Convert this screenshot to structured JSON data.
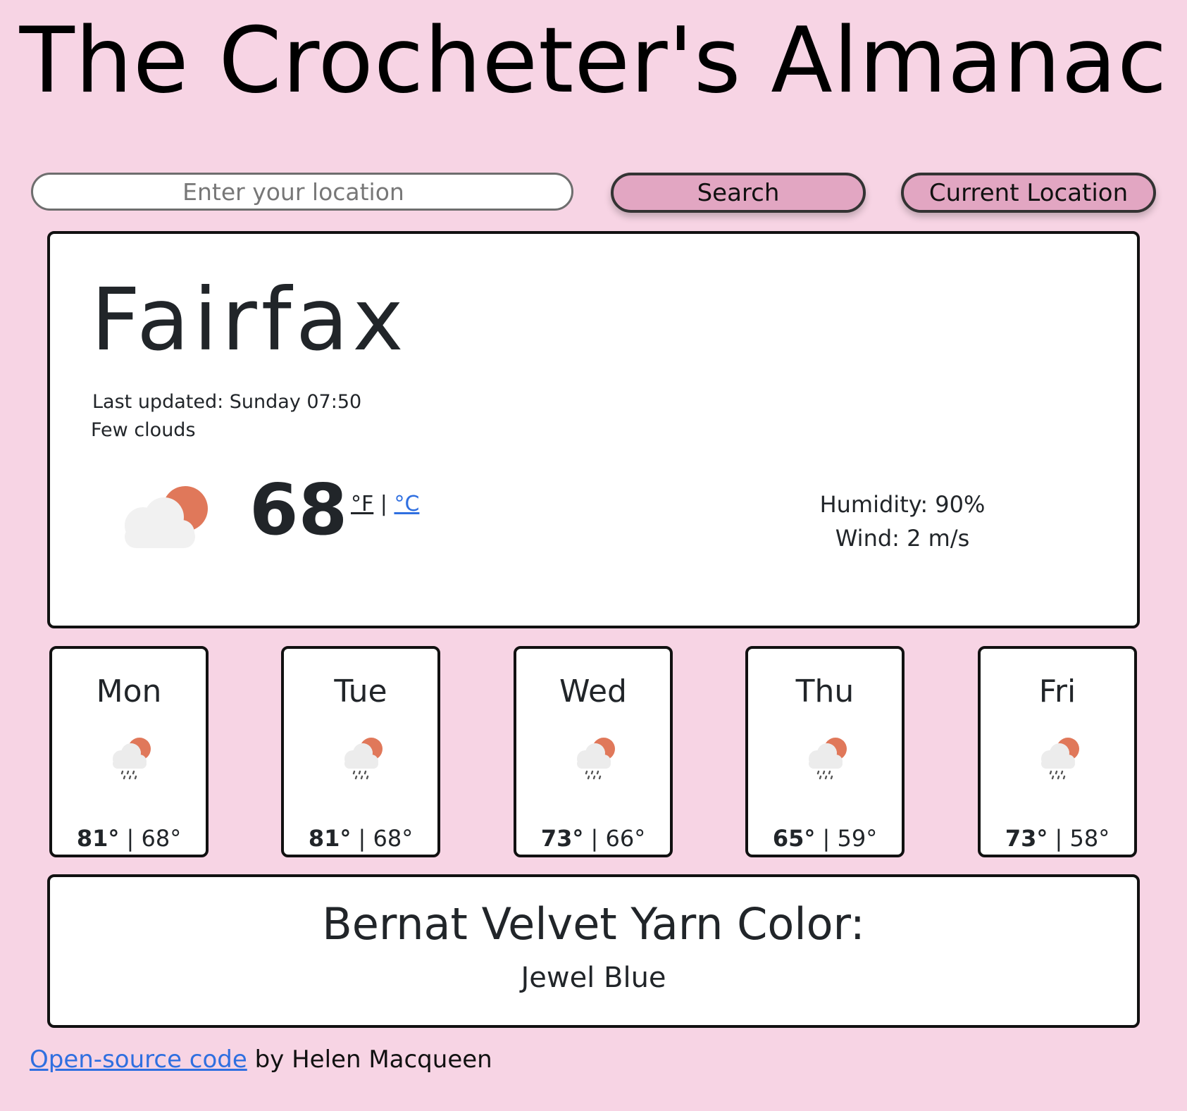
{
  "app": {
    "title": "The Crocheter's Almanac"
  },
  "search": {
    "placeholder": "Enter your location",
    "search_label": "Search",
    "current_location_label": "Current Location"
  },
  "current": {
    "city": "Fairfax",
    "last_updated": "Last updated: Sunday 07:50",
    "description": "Few clouds",
    "icon": "cloud-sun-icon",
    "temperature": "68",
    "unit_f": "°F",
    "unit_separator": " | ",
    "unit_c": "°C",
    "humidity": "Humidity: 90%",
    "wind": "Wind: 2 m/s"
  },
  "forecast": [
    {
      "day": "Mon",
      "max": "81°",
      "sep": " | ",
      "min": "68°",
      "icon": "cloud-sun-rain-icon"
    },
    {
      "day": "Tue",
      "max": "81°",
      "sep": " | ",
      "min": "68°",
      "icon": "cloud-sun-rain-icon"
    },
    {
      "day": "Wed",
      "max": "73°",
      "sep": " | ",
      "min": "66°",
      "icon": "cloud-sun-rain-icon"
    },
    {
      "day": "Thu",
      "max": "65°",
      "sep": " | ",
      "min": "59°",
      "icon": "cloud-sun-rain-icon"
    },
    {
      "day": "Fri",
      "max": "73°",
      "sep": " | ",
      "min": "58°",
      "icon": "cloud-sun-rain-icon"
    }
  ],
  "yarn": {
    "title": "Bernat Velvet Yarn Color:",
    "color_name": "Jewel Blue"
  },
  "footer": {
    "link_text": "Open-source code",
    "suffix": " by Helen Macqueen"
  },
  "colors": {
    "background": "#f7d4e4",
    "button": "#e2a6c2",
    "sun": "#e0785a",
    "cloud": "#f1f1f1",
    "link": "#2f6fe0"
  }
}
